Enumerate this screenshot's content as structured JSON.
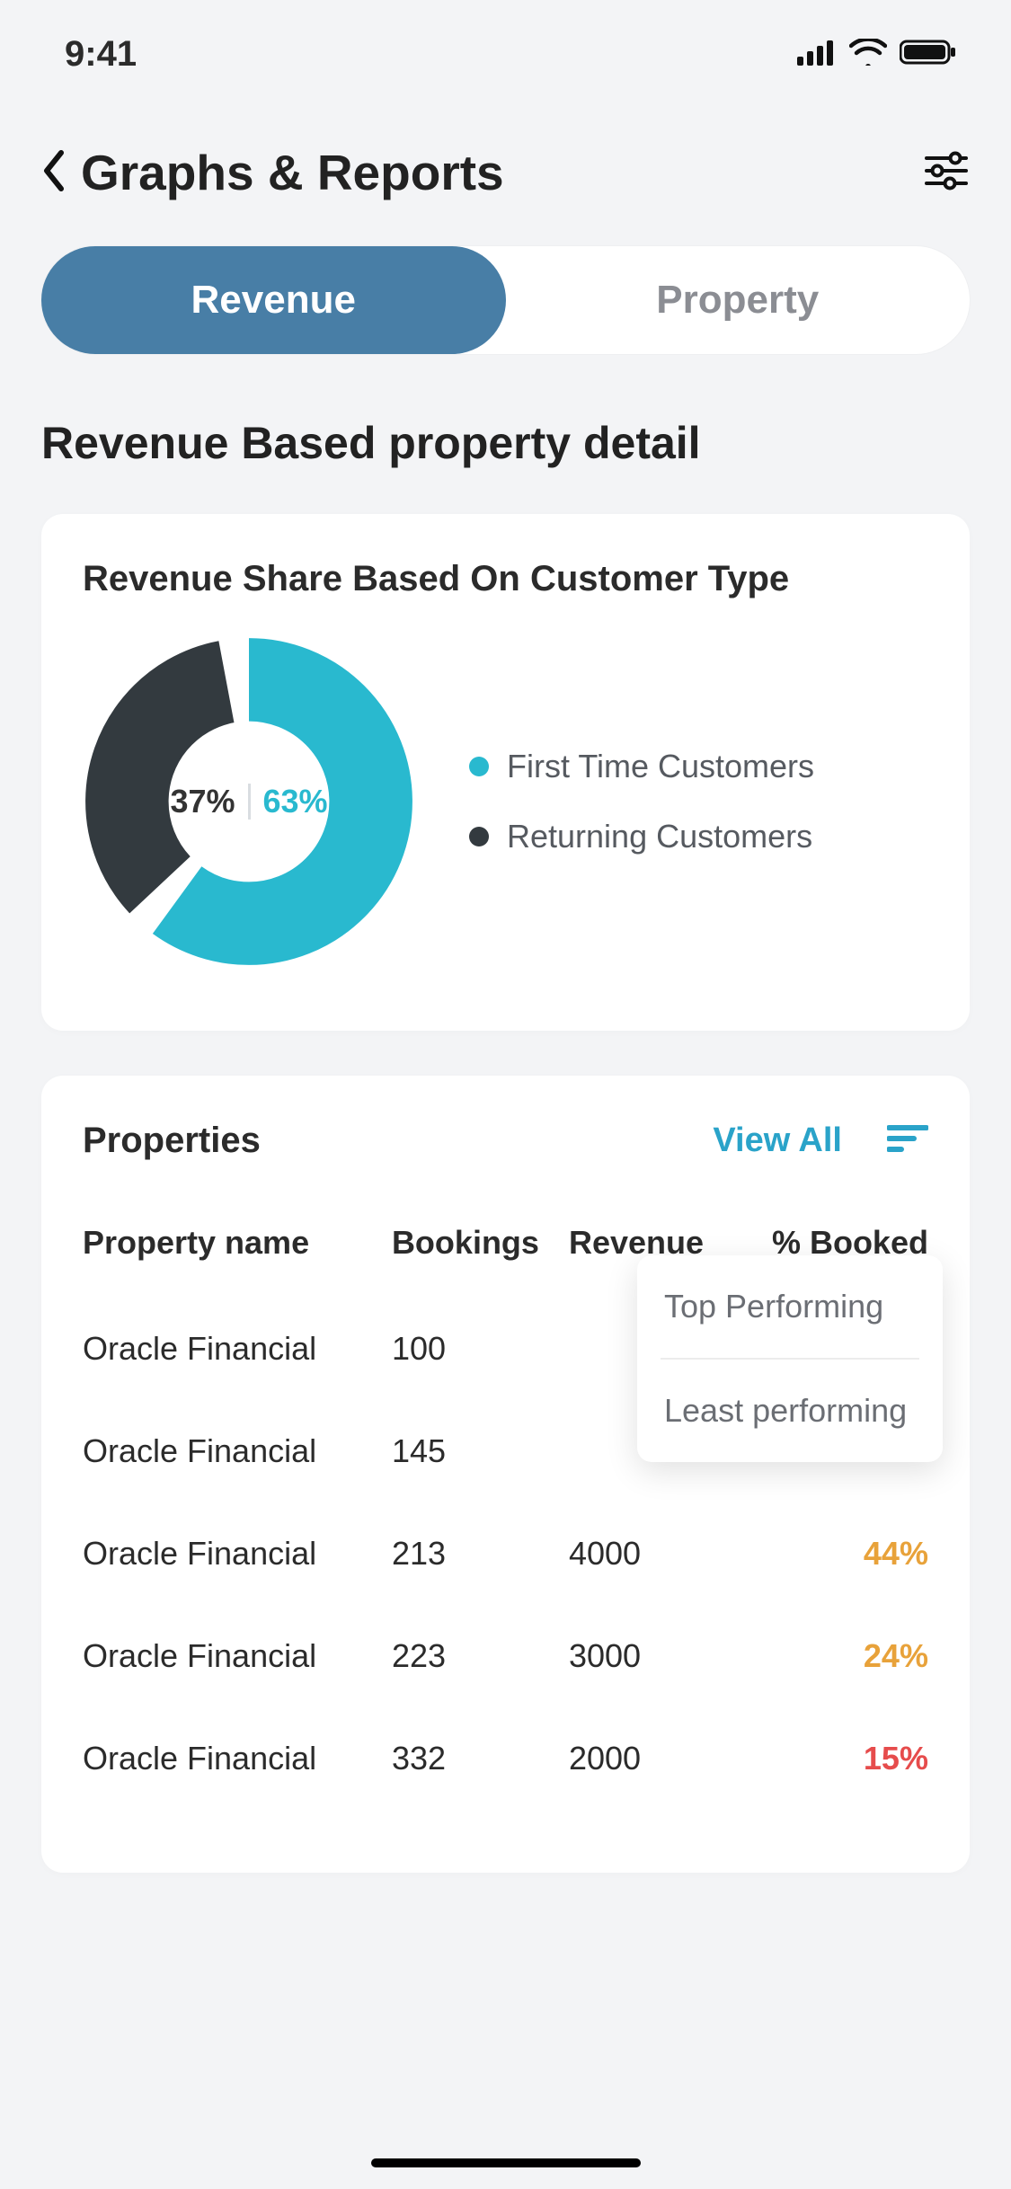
{
  "status_bar": {
    "time": "9:41"
  },
  "header": {
    "title": "Graphs & Reports"
  },
  "tabs": {
    "revenue": "Revenue",
    "property": "Property",
    "active": "revenue"
  },
  "section": {
    "title": "Revenue Based property detail"
  },
  "chart_data": {
    "type": "pie",
    "title": "Revenue Share Based On Customer Type",
    "categories": [
      "First Time Customers",
      "Returning Customers"
    ],
    "values": [
      63,
      37
    ],
    "colors": [
      "#29b9cf",
      "#333a3f"
    ],
    "legend_position": "right",
    "center_labels": [
      "37%",
      "63%"
    ]
  },
  "properties_card": {
    "title": "Properties",
    "view_all": "View All",
    "popover": {
      "option1": "Top Performing",
      "option2": "Least performing"
    },
    "columns": {
      "name": "Property name",
      "bookings": "Bookings",
      "revenue": "Revenue",
      "pct": "% Booked"
    },
    "rows": [
      {
        "name": "Oracle Financial",
        "bookings": "100",
        "revenue": "",
        "pct": "",
        "pct_color": ""
      },
      {
        "name": "Oracle Financial",
        "bookings": "145",
        "revenue": "",
        "pct": "",
        "pct_color": ""
      },
      {
        "name": "Oracle Financial",
        "bookings": "213",
        "revenue": "4000",
        "pct": "44%",
        "pct_color": "#e8a23a"
      },
      {
        "name": "Oracle Financial",
        "bookings": "223",
        "revenue": "3000",
        "pct": "24%",
        "pct_color": "#e8a23a"
      },
      {
        "name": "Oracle Financial",
        "bookings": "332",
        "revenue": "2000",
        "pct": "15%",
        "pct_color": "#e64c4c"
      }
    ]
  }
}
